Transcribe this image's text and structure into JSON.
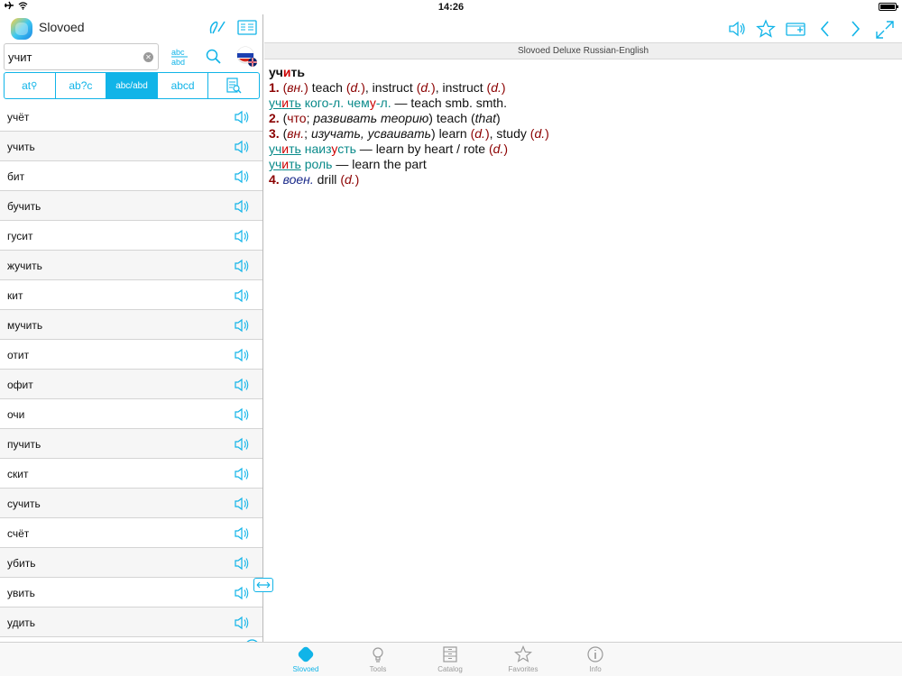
{
  "status": {
    "time": "14:26"
  },
  "app": {
    "title": "Slovoed"
  },
  "search": {
    "value": "учит"
  },
  "segments": [
    "at",
    "ab?c",
    "abc/abd",
    "abcd",
    ""
  ],
  "words": [
    "учёт",
    "учить",
    "бит",
    "бучить",
    "гусит",
    "жучить",
    "кит",
    "мучить",
    "отит",
    "офит",
    "очи",
    "пучить",
    "скит",
    "сучить",
    "счёт",
    "убить",
    "увить",
    "удить"
  ],
  "dictionary": {
    "name": "Slovoed Deluxe Russian-English"
  },
  "article": {
    "headword_pre": "уч",
    "headword_accent": "и",
    "headword_post": "ть",
    "s1": {
      "num": "1.",
      "gram": "вн.",
      "t1": "teach",
      "d": "d.",
      "t2": "instruct",
      "t3": "instruct"
    },
    "p1": {
      "u1": "уч",
      "a1": "и",
      "u2": "ть",
      "w2": "кого-л.",
      "w3a": "чем",
      "w3b": "у",
      "w3c": "-л.",
      "dash": "—",
      "trans": "teach smb. smth."
    },
    "s2": {
      "num": "2.",
      "chto": "что",
      "phrase": "развивать теорию",
      "trans": "teach",
      "that": "that"
    },
    "s3": {
      "num": "3.",
      "gram": "вн.",
      "syn": "изучать, усваивать",
      "t1": "learn",
      "t2": "study"
    },
    "p2": {
      "u1": "уч",
      "a1": "и",
      "u2": "ть",
      "w2a": "наиз",
      "w2b": "у",
      "w2c": "сть",
      "dash": "—",
      "trans": "learn by heart / rote"
    },
    "p3": {
      "u1": "уч",
      "a1": "и",
      "u2": "ть",
      "w2": "роль",
      "dash": "—",
      "trans": "learn the part"
    },
    "s4": {
      "num": "4.",
      "label": "воен.",
      "trans": "drill"
    }
  },
  "tabs": [
    "Slovoed",
    "Tools",
    "Catalog",
    "Favorites",
    "Info"
  ],
  "colors": {
    "accent": "#11b4e8",
    "dark_red": "#8b0000",
    "teal": "#0a8a8a"
  }
}
